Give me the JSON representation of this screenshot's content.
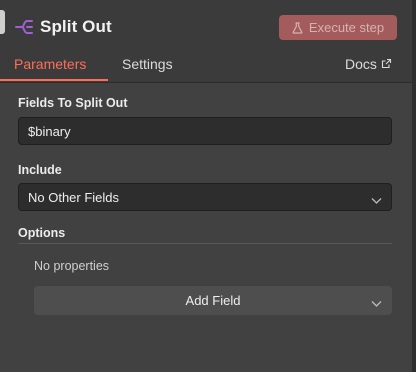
{
  "header": {
    "title": "Split Out",
    "node_icon": "split-out-icon",
    "execute_label": "Execute step",
    "execute_icon": "flask-icon"
  },
  "tabs": {
    "parameters": "Parameters",
    "settings": "Settings",
    "docs": "Docs",
    "docs_icon": "external-link-icon",
    "active": "Parameters"
  },
  "fields": {
    "split_label": "Fields To Split Out",
    "split_value": "$binary",
    "include_label": "Include",
    "include_value": "No Other Fields",
    "options_label": "Options",
    "no_properties": "No properties",
    "add_field_label": "Add Field"
  },
  "colors": {
    "accent": "#ff6d5a",
    "node_icon": "#a15fd6",
    "execute_bg": "#a35b5b"
  }
}
